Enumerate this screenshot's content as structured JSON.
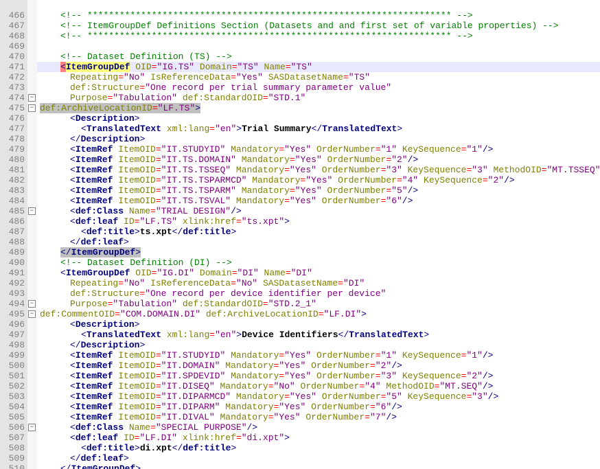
{
  "lines": [
    "",
    "466",
    "467",
    "468",
    "469",
    "470",
    "471",
    "472",
    "473",
    "474",
    "475",
    "476",
    "477",
    "478",
    "479",
    "480",
    "481",
    "482",
    "483",
    "484",
    "485",
    "486",
    "487",
    "488",
    "489",
    "490",
    "491",
    "492",
    "493",
    "494",
    "495",
    "496",
    "497",
    "498",
    "499",
    "500",
    "501",
    "502",
    "503",
    "504",
    "505",
    "506",
    "507",
    "508",
    "509",
    "510"
  ],
  "c": {
    "r0": "<!-- ******************************************************************** -->",
    "r1": "<!-- ItemGroupDef Definitions Section (Datasets and and first set of variable properties) -->",
    "r2": "<!-- ******************************************************************** -->",
    "r4": "<!-- Dataset Definition (TS) -->",
    "r24": "<!-- Dataset Definition (DI) -->"
  },
  "ts": {
    "tag": "ItemGroupDef",
    "OID": "IG.TS",
    "Domain": "TS",
    "Name": "TS",
    "Repeating": "No",
    "IsReferenceData": "Yes",
    "SASDatasetName": "TS",
    "Structure": "One record per trial summary parameter value",
    "Purpose": "Tabulation",
    "StandardOID": "STD.1",
    "ArchiveLocationID": "LF.TS",
    "Desc": "Trial Summary",
    "refs": [
      {
        "ItemOID": "IT.STUDYID",
        "Mandatory": "Yes",
        "OrderNumber": "1",
        "KeySequence": "1"
      },
      {
        "ItemOID": "IT.TS.DOMAIN",
        "Mandatory": "Yes",
        "OrderNumber": "2"
      },
      {
        "ItemOID": "IT.TS.TSSEQ",
        "Mandatory": "Yes",
        "OrderNumber": "3",
        "KeySequence": "3",
        "MethodOID": "MT.TSSEQ"
      },
      {
        "ItemOID": "IT.TS.TSPARMCD",
        "Mandatory": "Yes",
        "OrderNumber": "4",
        "KeySequence": "2"
      },
      {
        "ItemOID": "IT.TS.TSPARM",
        "Mandatory": "Yes",
        "OrderNumber": "5"
      },
      {
        "ItemOID": "IT.TS.TSVAL",
        "Mandatory": "Yes",
        "OrderNumber": "6"
      }
    ],
    "Class": "TRIAL DESIGN",
    "leafID": "LF.TS",
    "leafHref": "ts.xpt",
    "leafTitle": "ts.xpt"
  },
  "di": {
    "tag": "ItemGroupDef",
    "OID": "IG.DI",
    "Domain": "DI",
    "Name": "DI",
    "Repeating": "No",
    "IsReferenceData": "No",
    "SASDatasetName": "DI",
    "Structure": "One record per device identifier per device",
    "Purpose": "Tabulation",
    "StandardOID": "STD.2_1",
    "CommentOID": "COM.DOMAIN.DI",
    "ArchiveLocationID": "LF.DI",
    "Desc": "Device Identifiers",
    "refs": [
      {
        "ItemOID": "IT.STUDYID",
        "Mandatory": "Yes",
        "OrderNumber": "1",
        "KeySequence": "1"
      },
      {
        "ItemOID": "IT.DOMAIN",
        "Mandatory": "Yes",
        "OrderNumber": "2"
      },
      {
        "ItemOID": "IT.SPDEVID",
        "Mandatory": "Yes",
        "OrderNumber": "3",
        "KeySequence": "2"
      },
      {
        "ItemOID": "IT.DISEQ",
        "Mandatory": "No",
        "OrderNumber": "4",
        "MethodOID": "MT.SEQ"
      },
      {
        "ItemOID": "IT.DIPARMCD",
        "Mandatory": "Yes",
        "OrderNumber": "5",
        "KeySequence": "3"
      },
      {
        "ItemOID": "IT.DIPARM",
        "Mandatory": "Yes",
        "OrderNumber": "6"
      },
      {
        "ItemOID": "IT.DIVAL",
        "Mandatory": "Yes",
        "OrderNumber": "7"
      }
    ],
    "Class": "SPECIAL PURPOSE",
    "leafID": "LF.DI",
    "leafHref": "di.xpt",
    "leafTitle": "di.xpt"
  },
  "kw": {
    "ItemGroupDef": "ItemGroupDef",
    "OID": "OID",
    "Domain": "Domain",
    "Name": "Name",
    "Repeating": "Repeating",
    "IsReferenceData": "IsReferenceData",
    "SASDatasetName": "SASDatasetName",
    "defStructure": "def:Structure",
    "Purpose": "Purpose",
    "defStandardOID": "def:StandardOID",
    "defArchiveLocationID": "def:ArchiveLocationID",
    "defCommentOID": "def:CommentOID",
    "Description": "Description",
    "TranslatedText": "TranslatedText",
    "xmllang": "xml:lang",
    "en": "en",
    "ItemRef": "ItemRef",
    "ItemOID": "ItemOID",
    "Mandatory": "Mandatory",
    "OrderNumber": "OrderNumber",
    "KeySequence": "KeySequence",
    "MethodOID": "MethodOID",
    "defClass": "def:Class",
    "defleaf": "def:leaf",
    "ID": "ID",
    "xlinkhref": "xlink:href",
    "deftitle": "def:title"
  },
  "foldMarks": [
    {
      "line": 9,
      "sym": "−"
    },
    {
      "line": 10,
      "sym": "−"
    },
    {
      "line": 20,
      "sym": "−"
    },
    {
      "line": 29,
      "sym": "−"
    },
    {
      "line": 30,
      "sym": "−"
    },
    {
      "line": 41,
      "sym": "−"
    }
  ]
}
